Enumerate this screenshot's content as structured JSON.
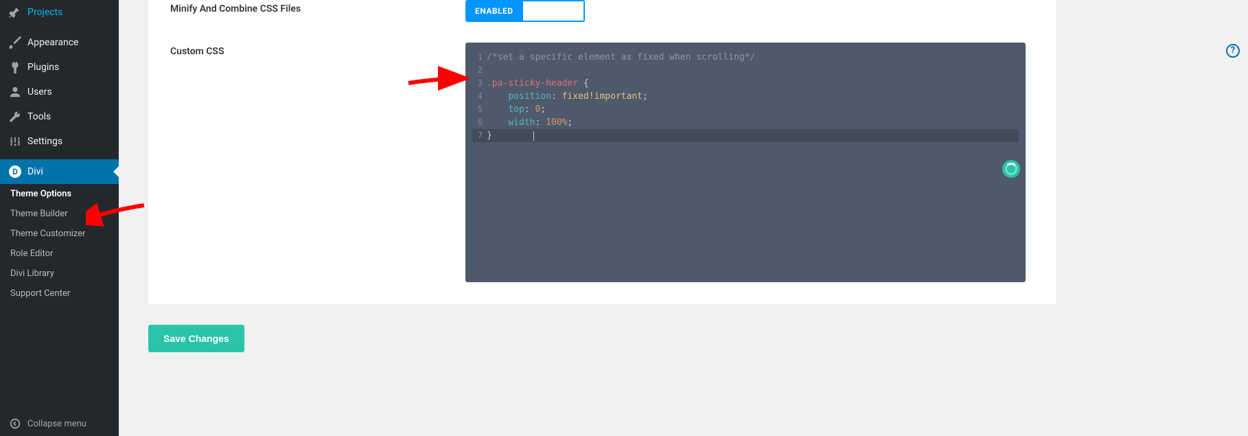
{
  "sidebar": {
    "items": [
      {
        "label": "Projects",
        "icon": "pin"
      },
      {
        "label": "Appearance",
        "icon": "brush"
      },
      {
        "label": "Plugins",
        "icon": "plug"
      },
      {
        "label": "Users",
        "icon": "user"
      },
      {
        "label": "Tools",
        "icon": "wrench"
      },
      {
        "label": "Settings",
        "icon": "sliders"
      },
      {
        "label": "Divi",
        "icon": "divi"
      }
    ],
    "submenu": [
      {
        "label": "Theme Options",
        "active": true
      },
      {
        "label": "Theme Builder"
      },
      {
        "label": "Theme Customizer"
      },
      {
        "label": "Role Editor"
      },
      {
        "label": "Divi Library"
      },
      {
        "label": "Support Center"
      }
    ],
    "collapse": "Collapse menu"
  },
  "options": {
    "minify_label": "Minify And Combine CSS Files",
    "toggle_on": "ENABLED",
    "custom_css_label": "Custom CSS",
    "code": {
      "line1": "/*set a specific element as fixed when scrolling*/",
      "line3_sel": ".pa-sticky-header",
      "line3_brace": " {",
      "line4_prop": "position",
      "line4_val": "fixed!important",
      "line5_prop": "top",
      "line5_val": "0",
      "line6_prop": "width",
      "line6_val": "100%",
      "line7": "}"
    }
  },
  "save_button": "Save Changes",
  "help": "?"
}
